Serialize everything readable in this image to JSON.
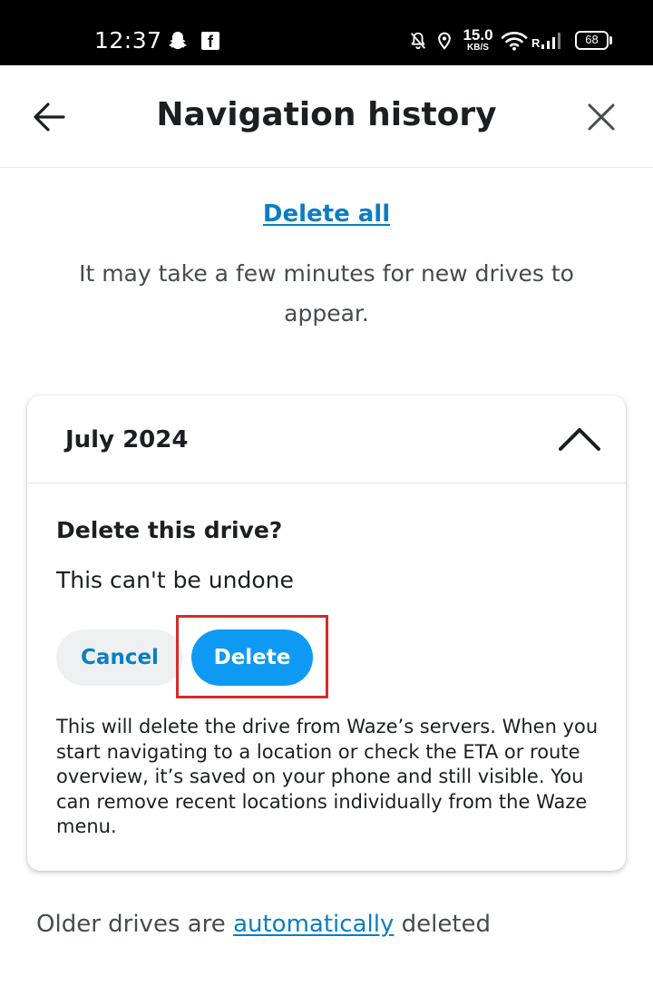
{
  "status_bar": {
    "time": "12:37",
    "network_speed_value": "15.0",
    "network_speed_unit": "KB/S",
    "battery_level": "68",
    "roaming_indicator": "R",
    "icons": [
      "snapchat-ghost-icon",
      "facebook-icon",
      "bell-muted-icon",
      "location-pin-icon",
      "wifi-icon",
      "signal-icon",
      "battery-icon"
    ]
  },
  "header": {
    "title": "Navigation history",
    "back_icon": "arrow-left-icon",
    "close_icon": "close-icon"
  },
  "main": {
    "delete_all_label": "Delete all",
    "info_text": "It may take a few minutes for new drives to appear."
  },
  "card": {
    "month": "July 2024",
    "expand_icon": "chevron-up-icon",
    "confirm_title": "Delete this drive?",
    "confirm_subtitle": "This can't be undone",
    "cancel_label": "Cancel",
    "delete_label": "Delete",
    "disclaimer": "This will delete the drive from Waze’s servers. When you start navigating to a location or check the ETA or route overview, it’s saved on your phone and still visible. You can remove recent locations individually from the Waze menu."
  },
  "footer": {
    "prefix": "Older drives are ",
    "link": "automatically",
    "suffix": " deleted"
  },
  "colors": {
    "link": "#0a7ec2",
    "primary_button": "#0e9af2",
    "secondary_button": "#eef0f2",
    "highlight": "#d42b2b"
  }
}
